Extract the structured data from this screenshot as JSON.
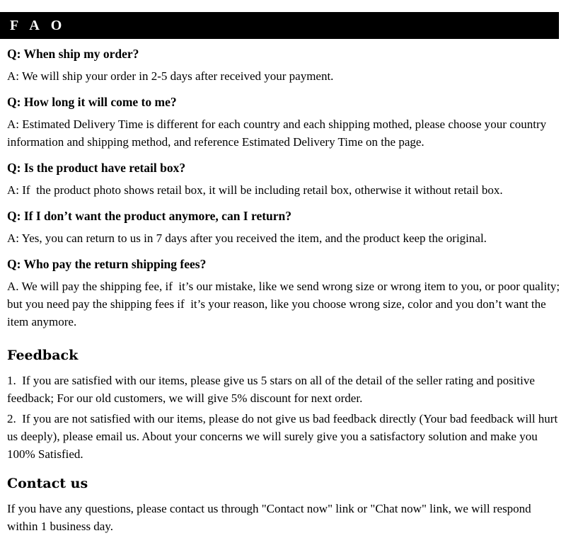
{
  "header": {
    "title": "F A O",
    "title_plain": "FAO",
    "background_color": "#000000",
    "text_color": "#ffffff"
  },
  "faq": {
    "items": [
      {
        "question": "Q: When ship my order?",
        "answer": "A: We will ship your order in 2-5 days after received your payment."
      },
      {
        "question": "Q: How long it will come to me?",
        "answer": "A: Estimated Delivery Time is different for each country and each shipping mothed, please choose your country information and shipping method, and reference Estimated Delivery Time on the page."
      },
      {
        "question": "Q: Is the product have retail box?",
        "answer": "A: If  the product photo shows retail box, it will be including retail box, otherwise it without retail box."
      },
      {
        "question": "Q: If I don’t want the product anymore, can I return?",
        "answer": "A: Yes, you can return to us in 7 days after you received the item, and the product keep the original."
      },
      {
        "question": "Q: Who pay the return shipping fees?",
        "answer": "A. We will pay the shipping fee, if  it’s our mistake, like we send wrong size or wrong item to you, or poor quality; but you need pay the shipping fees if  it’s your reason, like you choose wrong size, color and you don’t want the item anymore."
      }
    ]
  },
  "feedback": {
    "heading": "Feedback",
    "items": [
      "1.  If you are satisfied with our items, please give us 5 stars on all of the detail of the seller rating and positive feedback; For our old customers, we will give 5% discount for next order.",
      "2.  If you are not satisfied with our items, please do not give us bad feedback directly (Your bad feedback will hurt us deeply), please email us. About your concerns we will surely give you a satisfactory solution and make you 100% Satisfied."
    ]
  },
  "contact": {
    "heading": "Contact us",
    "paragraph": "If you have any questions, please contact us through \"Contact now\" link or \"Chat now\" link, we will respond within 1 business day."
  },
  "colors": {
    "page_background": "#ffffff",
    "text": "#000000",
    "header_bar": "#000000"
  }
}
